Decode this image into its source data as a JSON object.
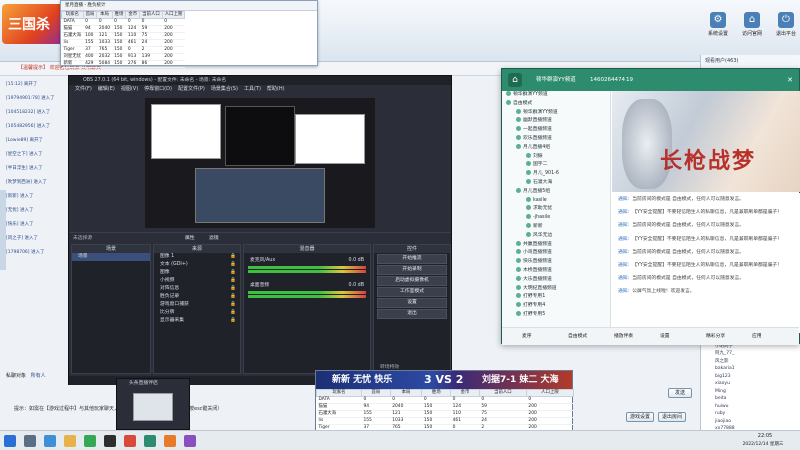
{
  "game": {
    "logo_text": "三国杀",
    "notice": "【温馨提示】  欢迎各位玩家  文明聊天",
    "left_chat": [
      "[15:12] 离开了",
      "[19794901:78] 进入了",
      "[104518232] 进入了",
      "[105482956] 进入了",
      "[Lowie89] 离开了",
      "[星空之下] 进入了",
      "[半日浮生] 进入了",
      "[吹梦到西洲] 进入了",
      "[新新] 进入了",
      "[无忧] 进入了",
      "[快乐] 进入了",
      "[风之子] 进入了",
      "[1798706] 进入了"
    ],
    "chat_input_label": "私聊对象",
    "chat_input_value": "所有人",
    "hint_text": "提示：如需在【游戏过程中】与其他玩家聊天，请按键盘上的回车键发送消息（按esc键关闭）",
    "buttons": [
      {
        "label": "系统设置",
        "icon": "gear-icon",
        "glyph": "⚙"
      },
      {
        "label": "访问官网",
        "icon": "home-icon",
        "glyph": "⌂"
      },
      {
        "label": "退出平台",
        "icon": "exit-icon",
        "glyph": "⏻"
      }
    ],
    "right_header": "观看用户(463)",
    "right_list": [
      "sanguo",
      "小明同学",
      "阿九_77_",
      "风之影",
      "bakaria1",
      "big123",
      "xiaoyu",
      "Ming",
      "beita",
      "huiwu",
      "ruby",
      "jiaojiao",
      "xx77888",
      "justin92",
      "ppe"
    ],
    "send_btn": "发送",
    "setting_btn": "游戏设置",
    "exit_btn": "退出房间"
  },
  "stats": {
    "title": "星月直播 - 胜负统计",
    "headers": [
      "玩家名",
      "首局",
      "本局",
      "胜场",
      "金币",
      "当前人口",
      "人口上限"
    ],
    "rows": [
      [
        "DATA",
        "0",
        "0",
        "0",
        "0",
        "0",
        "0"
      ],
      [
        "猫猫",
        "94",
        "2040",
        "150",
        "124",
        "59",
        "200"
      ],
      [
        "石灌大海",
        "100",
        "121",
        "150",
        "110",
        "75",
        "200"
      ],
      [
        "lis",
        "155",
        "1033",
        "150",
        "461",
        "24",
        "200"
      ],
      [
        "Tiger",
        "37",
        "765",
        "150",
        "0",
        "2",
        "200"
      ],
      [
        "刘星无忧",
        "400",
        "2032",
        "150",
        "913",
        "139",
        "200"
      ],
      [
        "新新",
        "429",
        "5084",
        "150",
        "276",
        "86",
        "200"
      ]
    ]
  },
  "obs": {
    "title": "OBS 27.0.1 (64 bit, windows) - 配置文件: 未命名 - 场景: 未命名",
    "menu": [
      "文件(F)",
      "编辑(E)",
      "视图(V)",
      "停靠窗口(D)",
      "配置文件(P)",
      "场景集合(S)",
      "工具(T)",
      "帮助(H)"
    ],
    "scenes_header": "场景",
    "scenes": [
      "场景"
    ],
    "sources_header": "来源",
    "sources": [
      "图像 1",
      "文本 (GDI+)",
      "图像",
      "小视频",
      "对阵信息",
      "胜负记录",
      "游戏窗口捕获",
      "比分牌",
      "显示器采集"
    ],
    "mixer_header": "混音器",
    "mixer": [
      {
        "name": "麦克风/Aux",
        "db": "0.0 dB"
      },
      {
        "name": "桌面音频",
        "db": "0.0 dB"
      }
    ],
    "controls_header": "控件",
    "controls": [
      "开始推流",
      "开始录制",
      "启动虚拟摄像机",
      "工作室模式",
      "设置",
      "退出"
    ],
    "transitions_header": "转场特效",
    "status": "LIVE: 00:00:00  REC: 00:00:00  CPU: 3.6%, 30.00 fps",
    "no_source": "未选择源",
    "props_btn": "属性",
    "filters_btn": "滤镜"
  },
  "yy": {
    "title": "顿华群演YY频道",
    "channel_id": "1460264474",
    "online": "19",
    "tree": [
      {
        "label": "顿华群演YY频道",
        "level": 0
      },
      {
        "label": "自由模式",
        "level": 0
      },
      {
        "label": "顿华群演YY频道",
        "level": 1
      },
      {
        "label": "幽默直播频道",
        "level": 1
      },
      {
        "label": "一起直播频道",
        "level": 1
      },
      {
        "label": "欢乐直播频道",
        "level": 1
      },
      {
        "label": "月儿直播4组",
        "level": 1
      },
      {
        "label": "刘振",
        "level": 2
      },
      {
        "label": "国宇二",
        "level": 2
      },
      {
        "label": "月儿_901-6",
        "level": 2
      },
      {
        "label": "石灌大海",
        "level": 2
      },
      {
        "label": "月儿直播5组",
        "level": 1
      },
      {
        "label": "kasile",
        "level": 2
      },
      {
        "label": "求助无忧",
        "level": 2
      },
      {
        "label": "-jhasile",
        "level": 2
      },
      {
        "label": "新新",
        "level": 2
      },
      {
        "label": "风华无边",
        "level": 2
      },
      {
        "label": "共赢直播频道",
        "level": 1
      },
      {
        "label": "小哥直播频道",
        "level": 1
      },
      {
        "label": "快乐直播频道",
        "level": 1
      },
      {
        "label": "木桥直播频道",
        "level": 1
      },
      {
        "label": "大乐直播频道",
        "level": 1
      },
      {
        "label": "大明纪直播频道",
        "level": 1
      },
      {
        "label": "打野专用1",
        "level": 1
      },
      {
        "label": "打野专用4",
        "level": 1
      },
      {
        "label": "打野专用5",
        "level": 1
      }
    ],
    "messages": [
      {
        "who": "通知:",
        "text": "当前房间的模式是 自由模式，任何人可以随意发言。"
      },
      {
        "who": "通知:",
        "text": "【YY安全提醒】不要轻信陌生人的私聊信息，凡是兼职刷单都是骗子！"
      },
      {
        "who": "通知:",
        "text": "当前房间的模式是 自由模式，任何人可以随意发言。"
      },
      {
        "who": "通知:",
        "text": "【YY安全提醒】不要轻信陌生人的私聊信息，凡是兼职刷单都是骗子！"
      },
      {
        "who": "通知:",
        "text": "当前房间的模式是 自由模式，任何人可以随意发言。"
      },
      {
        "who": "通知:",
        "text": "【YY安全提醒】不要轻信陌生人的私聊信息，凡是兼职刷单都是骗子！"
      },
      {
        "who": "通知:",
        "text": "当前房间的模式是 自由模式，任何人可以随意发言。"
      },
      {
        "who": "通知:",
        "text": "公屏气氛上线啦！欢迎发言。"
      }
    ],
    "bottom_items": [
      "麦序",
      "自由模式",
      "播放伴奏",
      "设置",
      "精彩分享",
      "应用"
    ],
    "banner_text": "长枪战梦"
  },
  "score": {
    "left_team": "新新 无忧 快乐",
    "vs": "3 VS 2",
    "right_team": "刘据7-1 妹二 大海",
    "headers": [
      "玩家名",
      "首局",
      "本局",
      "胜场",
      "金币",
      "当前人口",
      "人口上限"
    ],
    "rows": [
      [
        "DATA",
        "0",
        "0",
        "0",
        "0",
        "0",
        "0"
      ],
      [
        "猫猫",
        "94",
        "2040",
        "150",
        "124",
        "59",
        "200"
      ],
      [
        "石灌大海",
        "155",
        "121",
        "150",
        "110",
        "75",
        "200"
      ],
      [
        "lis",
        "155",
        "1033",
        "150",
        "461",
        "24",
        "200"
      ],
      [
        "Tiger",
        "37",
        "765",
        "150",
        "0",
        "2",
        "200"
      ],
      [
        "刘星无忧",
        "400",
        "2032",
        "150",
        "913",
        "139",
        "200"
      ],
      [
        "新新",
        "429",
        "5084",
        "150",
        "276",
        "86",
        "200"
      ]
    ]
  },
  "preview": {
    "label": "头条直播伴侣"
  },
  "taskbar": {
    "time": "22:05",
    "date": "2022/12/14 星期三"
  },
  "colors": {
    "accent": "#2d8c6e",
    "obs_bg": "#2b2e38",
    "banner_red": "#b8302a"
  }
}
